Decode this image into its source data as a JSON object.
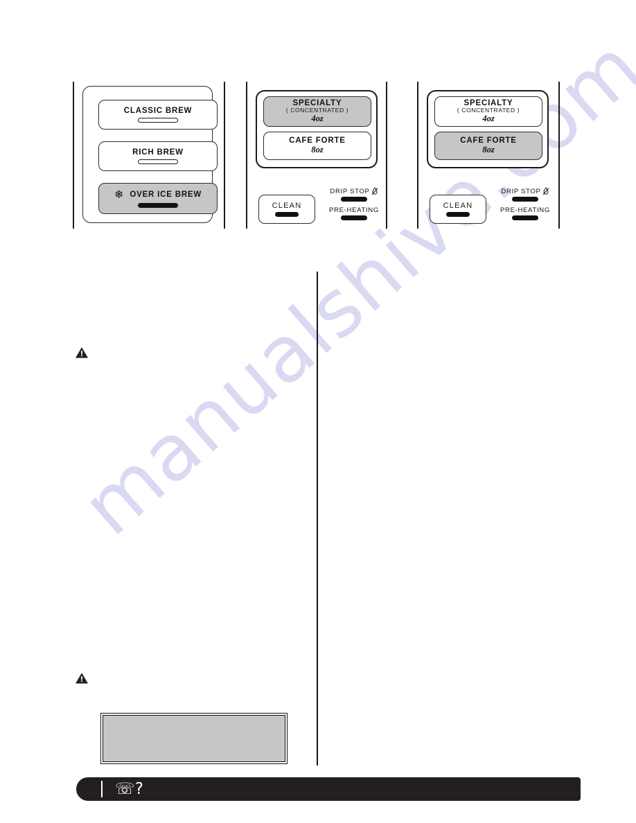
{
  "page": {
    "watermark_text": "manualshive.com",
    "background_color": "#ffffff",
    "accent_dark": "#231f20",
    "button_gray": "#c6c6c6"
  },
  "panels": [
    {
      "name": "classic-brew-panel",
      "buttons": [
        {
          "label": "CLASSIC BREW",
          "sub": "",
          "size": "",
          "highlighted": false,
          "led_on": false,
          "icon": ""
        },
        {
          "label": "RICH BREW",
          "sub": "",
          "size": "",
          "highlighted": false,
          "led_on": false,
          "icon": ""
        },
        {
          "label": "OVER ICE BREW",
          "sub": "",
          "size": "",
          "highlighted": true,
          "led_on": true,
          "icon": "snowflake-icon"
        }
      ]
    },
    {
      "name": "specialty-selected-panel",
      "group_buttons": [
        {
          "label": "SPECIALTY",
          "sub": "( CONCENTRATED )",
          "size": "4oz",
          "highlighted": true
        },
        {
          "label": "CAFE  FORTE",
          "sub": "",
          "size": "8oz",
          "highlighted": false
        }
      ],
      "clean": {
        "label": "CLEAN",
        "led_on": true
      },
      "indicators": [
        {
          "label": "DRIP  STOP",
          "icon": "drip-stop-icon",
          "led_on": true
        },
        {
          "label": "PRE-HEATING",
          "icon": "",
          "led_on": true
        }
      ]
    },
    {
      "name": "cafe-forte-selected-panel",
      "group_buttons": [
        {
          "label": "SPECIALTY",
          "sub": "( CONCENTRATED )",
          "size": "4oz",
          "highlighted": false
        },
        {
          "label": "CAFE  FORTE",
          "sub": "",
          "size": "8oz",
          "highlighted": true
        }
      ],
      "clean": {
        "label": "CLEAN",
        "led_on": true
      },
      "indicators": [
        {
          "label": "DRIP  STOP",
          "icon": "drip-stop-icon",
          "led_on": true
        },
        {
          "label": "PRE-HEATING",
          "icon": "",
          "led_on": true
        }
      ]
    }
  ],
  "callouts": [
    {
      "name": "warning-top",
      "icon": "warning-triangle-icon"
    },
    {
      "name": "warning-bottom",
      "icon": "warning-triangle-icon"
    }
  ],
  "gray_panel": {
    "name": "note-box",
    "text": ""
  },
  "footer": {
    "name": "help-bar",
    "phone_icon": "telephone-icon",
    "question_mark": "?"
  }
}
